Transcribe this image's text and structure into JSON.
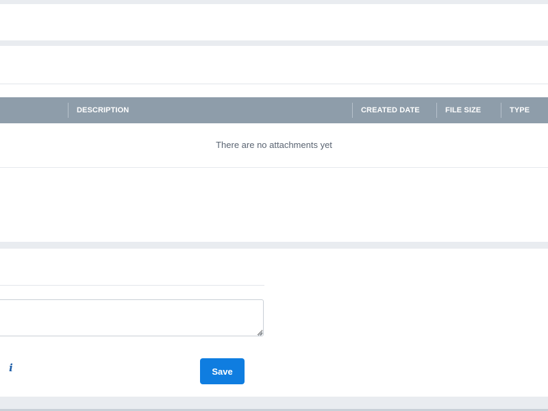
{
  "attachments": {
    "columns": [
      "DESCRIPTION",
      "CREATED DATE",
      "FILE SIZE",
      "TYPE"
    ],
    "empty_message": "There are no attachments yet"
  },
  "form": {
    "comment_value": "",
    "save_label": "Save",
    "info_icon_glyph": "i",
    "info_icon": "info-icon"
  },
  "colors": {
    "table_header_bg": "#8e9daa",
    "primary_button": "#0f7de0",
    "page_bg": "#e9ecf0"
  }
}
